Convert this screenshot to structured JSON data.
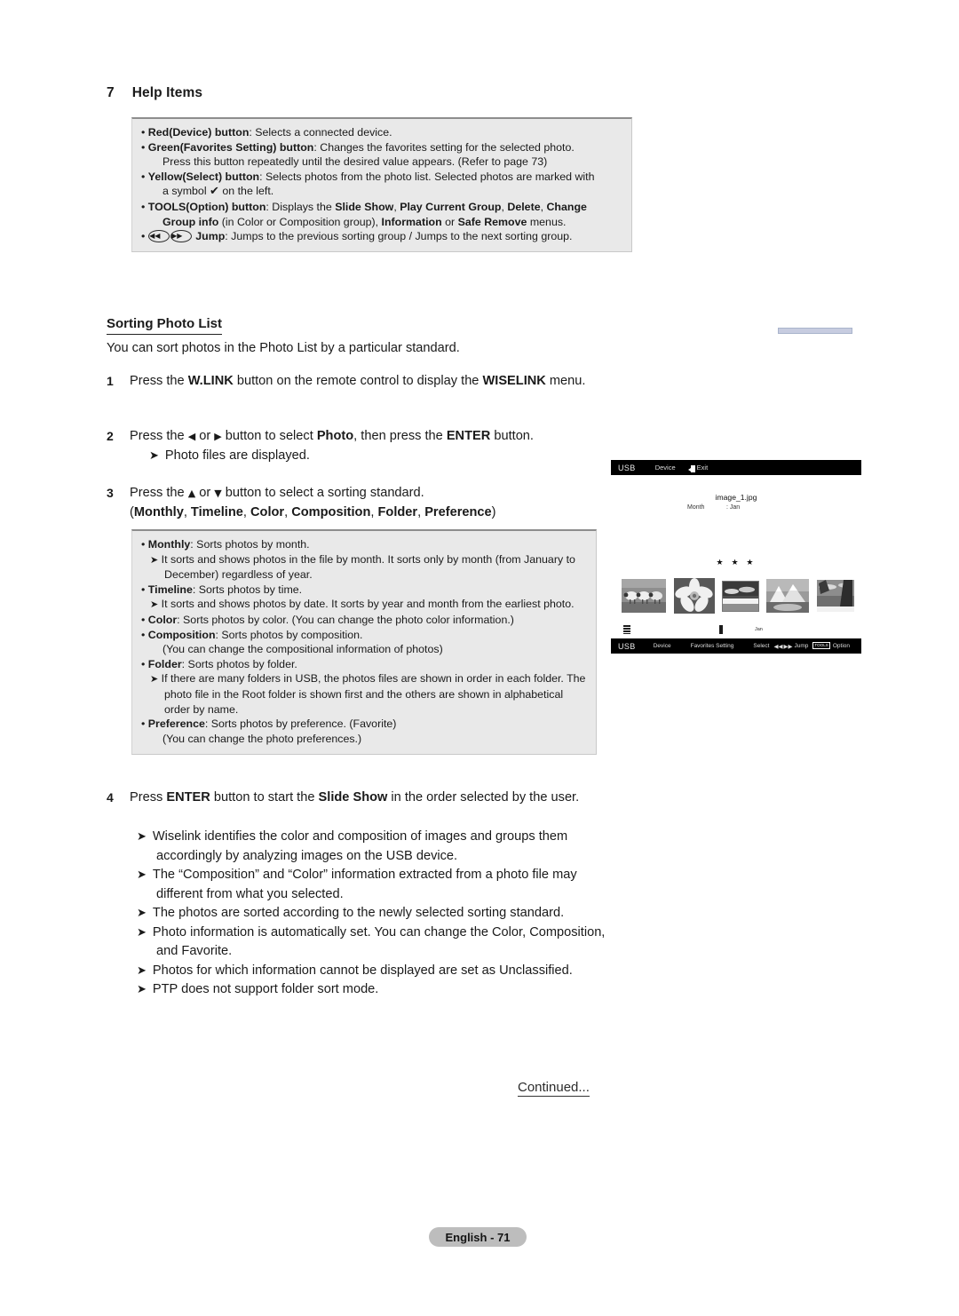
{
  "help_section": {
    "number": "7",
    "title": "Help Items",
    "items": [
      {
        "label": "Red(Device) button",
        "text": ": Selects a connected device."
      },
      {
        "label": "Green(Favorites Setting) button",
        "text": ": Changes the favorites setting for the selected photo.",
        "continuation": "Press this button repeatedly until the desired value appears. (Refer to page 73)"
      },
      {
        "label": "Yellow(Select) button",
        "text": ": Selects photos from the photo list. Selected photos are marked with",
        "continuation": "a symbol ✔ on the left."
      },
      {
        "label": "TOOLS(Option) button",
        "text": ": Displays the Slide Show, Play Current Group, Delete, Change",
        "continuation": "Group info (in Color or Composition group), Information or Safe Remove menus."
      },
      {
        "label": "Jump",
        "text": ": Jumps to the previous sorting group / Jumps to the next sorting group.",
        "icon_prev": "rewind-icon",
        "icon_next": "fast-forward-icon"
      }
    ]
  },
  "sorting_section": {
    "title": "Sorting Photo List",
    "lead": "You can sort photos in the Photo List by a particular standard.",
    "steps": [
      {
        "number": "1",
        "text": "Press the W.LINK button on the remote control to display the WISELINK menu."
      },
      {
        "number": "2",
        "text": "Press the ◀ or ▶ button to select Photo, then press the ENTER button.",
        "note": "Photo files are displayed."
      },
      {
        "number": "3",
        "text": "Press the ▲ or ▼ button to select a sorting standard.",
        "line2": "(Monthly, Timeline, Color, Composition, Folder, Preference)"
      },
      {
        "number": "4",
        "text": "Press ENTER button to start the Slide Show in the order selected by the user."
      }
    ],
    "sort_options": [
      {
        "label": "Monthly",
        "text": ": Sorts photos by month.",
        "note": "It sorts and shows photos in the file by month. It sorts only by month (from January to December) regardless of year."
      },
      {
        "label": "Timeline",
        "text": ": Sorts photos by time.",
        "note": "It sorts and shows photos by date. It sorts by year and month from the earliest photo."
      },
      {
        "label": "Color",
        "text": ": Sorts photos by color. (You can change the photo color information.)"
      },
      {
        "label": "Composition",
        "text": ": Sorts photos by composition.",
        "plain": "(You can change the compositional information of photos)"
      },
      {
        "label": "Folder",
        "text": ": Sorts photos by folder.",
        "note": "If there are many folders in USB, the photos files are shown in order in each folder. The photo file in the Root folder is shown first and the others are shown in alphabetical order by name."
      },
      {
        "label": "Preference",
        "text": ": Sorts photos by preference. (Favorite)",
        "plain": "(You can change the photo preferences.)"
      }
    ],
    "step4_notes": [
      "Wiselink identifies the color and composition of images and groups them accordingly by analyzing images on the USB device.",
      "The “Composition” and “Color” information extracted from a photo file may different from what you selected.",
      "The photos are sorted according to the newly selected sorting standard.",
      "Photo information is automatically set. You can change the Color, Composition, and Favorite.",
      "Photos for which information cannot be displayed are set as Unclassified.",
      "PTP does not support folder sort mode."
    ]
  },
  "tv_screen": {
    "top_bar": {
      "source": "USB",
      "device": "Device",
      "exit": "Exit",
      "exit_icon": "exit-icon"
    },
    "filename": "image_1.jpg",
    "meta_key": "Month",
    "meta_value": ": Jan",
    "stars": "★ ★ ★",
    "group_label": "Jan",
    "bottom_bar": {
      "source": "USB",
      "device": "Device",
      "favorites": "Favorites Setting",
      "select": "Select",
      "jump": "Jump",
      "jump_icon_prev": "rewind-icon",
      "jump_icon_next": "fast-forward-icon",
      "tools_chip": "TOOLS",
      "option": "Option"
    },
    "thumbnails": [
      {
        "name": "sheep-photo",
        "selected": false
      },
      {
        "name": "flower-photo",
        "selected": false
      },
      {
        "name": "sky-photo",
        "selected": true
      },
      {
        "name": "mountain-photo",
        "selected": false
      },
      {
        "name": "tree-photo",
        "selected": false
      }
    ]
  },
  "continued": "Continued...",
  "footer": "English - 71"
}
